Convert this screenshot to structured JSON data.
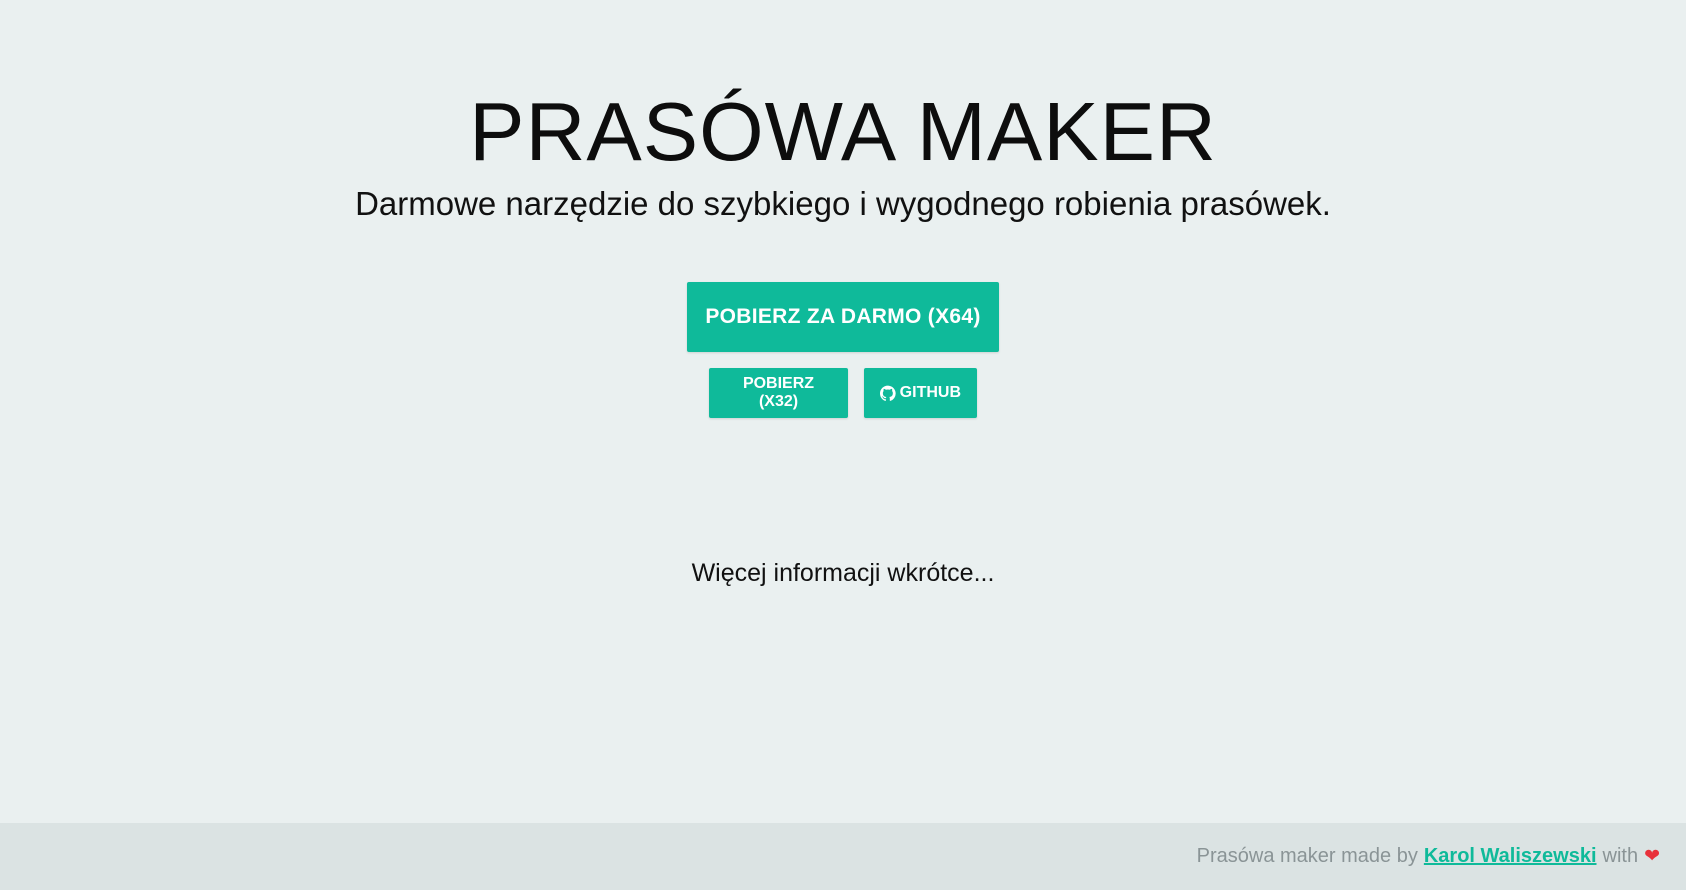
{
  "hero": {
    "title": "PRASÓWA MAKER",
    "subtitle": "Darmowe narzędzie do szybkiego i wygodnego robienia prasówek."
  },
  "buttons": {
    "download_x64": "POBIERZ ZA DARMO (x64)",
    "download_x32": "POBIERZ (x32)",
    "github": "GITHUB"
  },
  "info_text": "Więcej informacji wkrótce...",
  "footer": {
    "prefix": "Prasówa maker made by",
    "author": "Karol Waliszewski",
    "suffix": "with",
    "heart_icon": "❤"
  },
  "colors": {
    "accent": "#0fba9a",
    "background": "#eaf0f0",
    "footer_bg": "#dbe3e3",
    "heart": "#e8323b"
  },
  "icons": {
    "github": "github-icon",
    "heart": "heart-icon"
  }
}
